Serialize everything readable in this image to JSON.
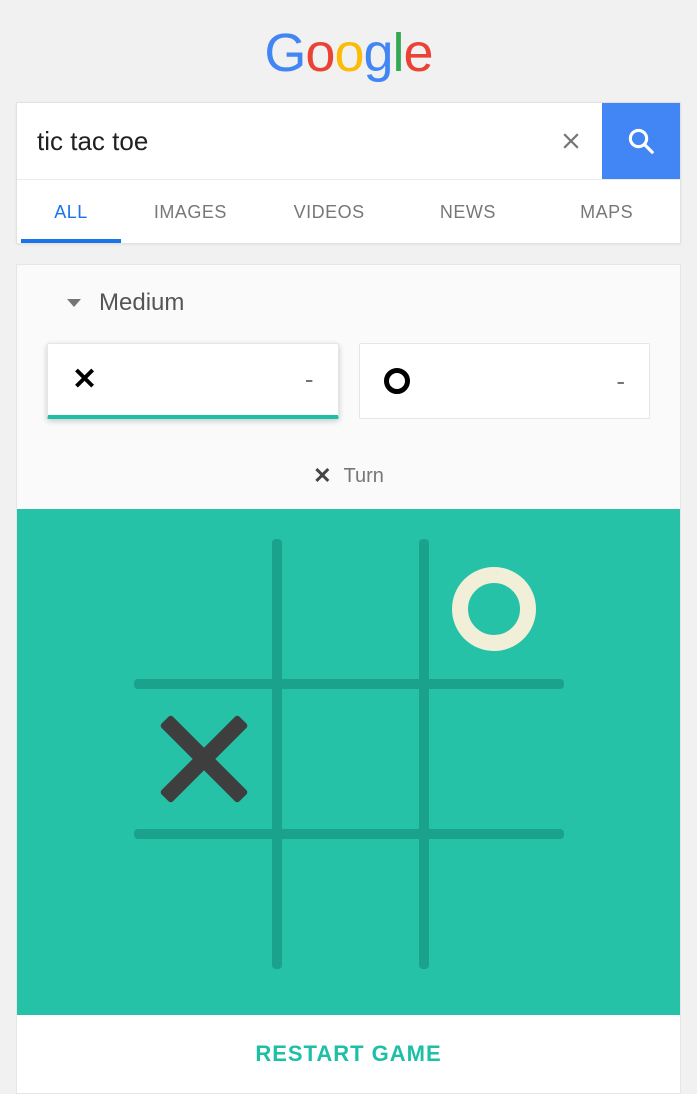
{
  "logo": {
    "text": "Google"
  },
  "search": {
    "value": "tic tac toe",
    "placeholder": "Search"
  },
  "tabs": [
    {
      "label": "ALL",
      "active": true
    },
    {
      "label": "IMAGES",
      "active": false
    },
    {
      "label": "VIDEOS",
      "active": false
    },
    {
      "label": "NEWS",
      "active": false
    },
    {
      "label": "MAPS",
      "active": false
    }
  ],
  "game": {
    "difficulty": "Medium",
    "score_x": "-",
    "score_o": "-",
    "turn_label": "Turn",
    "turn_player": "X",
    "restart_label": "RESTART GAME",
    "board": [
      [
        "",
        "",
        "O"
      ],
      [
        "X",
        "",
        ""
      ],
      [
        "",
        "",
        ""
      ]
    ]
  },
  "icons": {
    "clear": "close-icon",
    "search": "search-icon",
    "dropdown": "chevron-down-icon"
  }
}
